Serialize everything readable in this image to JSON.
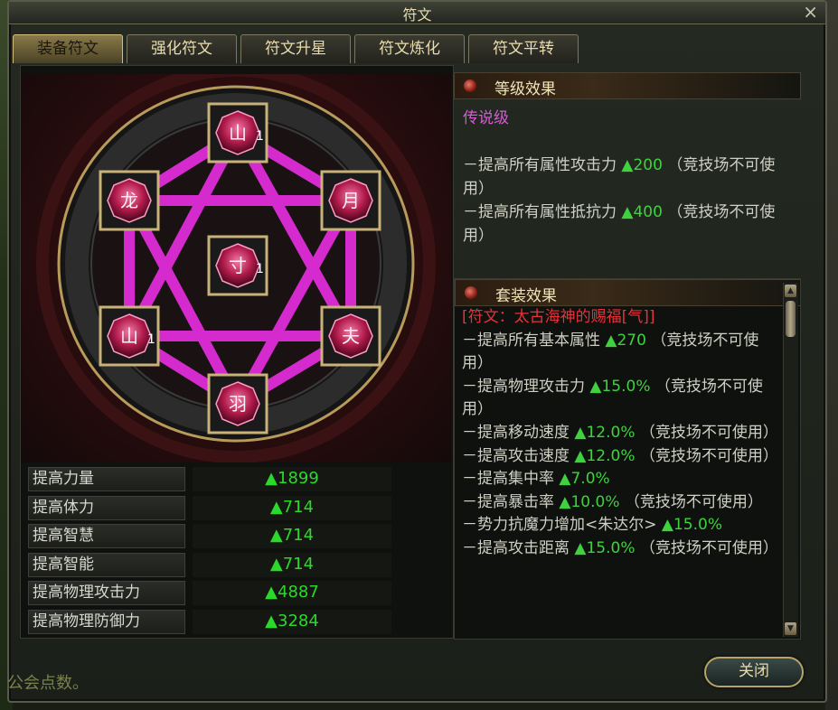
{
  "window": {
    "title": "符文",
    "close_glyph": "×"
  },
  "tabs": [
    {
      "label": "装备符文",
      "active": true
    },
    {
      "label": "强化符文",
      "active": false
    },
    {
      "label": "符文升星",
      "active": false
    },
    {
      "label": "符文炼化",
      "active": false
    },
    {
      "label": "符文平转",
      "active": false
    }
  ],
  "runes": [
    {
      "slot": "top",
      "glyph": "山",
      "level": "1"
    },
    {
      "slot": "upper-left",
      "glyph": "龙",
      "level": ""
    },
    {
      "slot": "upper-right",
      "glyph": "月",
      "level": ""
    },
    {
      "slot": "center",
      "glyph": "寸",
      "level": "1"
    },
    {
      "slot": "lower-left",
      "glyph": "山",
      "level": "1"
    },
    {
      "slot": "lower-right",
      "glyph": "夫",
      "level": ""
    },
    {
      "slot": "bottom",
      "glyph": "羽",
      "level": ""
    }
  ],
  "stats": [
    {
      "label": "提高力量",
      "value": "▲1899"
    },
    {
      "label": "提高体力",
      "value": "▲714"
    },
    {
      "label": "提高智慧",
      "value": "▲714"
    },
    {
      "label": "提高智能",
      "value": "▲714"
    },
    {
      "label": "提高物理攻击力",
      "value": "▲4887"
    },
    {
      "label": "提高物理防御力",
      "value": "▲3284"
    }
  ],
  "grade_effect": {
    "header": "等级效果",
    "legend": "传说级",
    "lines": [
      {
        "text": "－提高所有属性攻击力",
        "value": "▲200",
        "note": "（竞技场不可使用）"
      },
      {
        "text": "－提高所有属性抵抗力",
        "value": "▲400",
        "note": "（竞技场不可使用）"
      }
    ]
  },
  "set_effect": {
    "header": "套装效果",
    "title": "[符文：太古海神的赐福[气]]",
    "lines": [
      {
        "text": "－提高所有基本属性",
        "value": "▲270",
        "note": "（竞技场不可使用）"
      },
      {
        "text": "－提高物理攻击力",
        "value": "▲15.0%",
        "note": "（竞技场不可使用）"
      },
      {
        "text": "－提高移动速度",
        "value": "▲12.0%",
        "note": "（竞技场不可使用）"
      },
      {
        "text": "－提高攻击速度",
        "value": "▲12.0%",
        "note": "（竞技场不可使用）"
      },
      {
        "text": "－提高集中率",
        "value": "▲7.0%",
        "note": ""
      },
      {
        "text": "－提高暴击率",
        "value": "▲10.0%",
        "note": "（竞技场不可使用）"
      },
      {
        "text": "－势力抗魔力增加<朱达尔>",
        "value": "▲15.0%",
        "note": ""
      },
      {
        "text": "－提高攻击距离",
        "value": "▲15.0%",
        "note": "（竞技场不可使用）"
      }
    ]
  },
  "buttons": {
    "close": "关闭"
  },
  "background_text": "公会点数。",
  "colors": {
    "value_green": "#3fd13f",
    "legend_purple": "#d35cd3",
    "set_title_red": "#e8323a",
    "pentagram_pink": "#e02cd8"
  }
}
